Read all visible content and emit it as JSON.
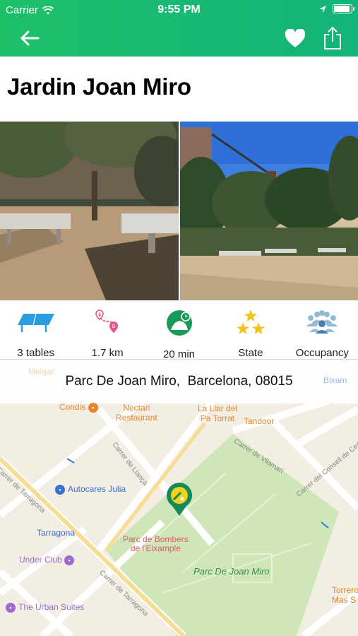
{
  "status_bar": {
    "carrier": "Carrier",
    "time": "9:55 PM"
  },
  "header": {
    "back_icon": "arrow-left-icon",
    "favorite_icon": "heart-icon",
    "share_icon": "share-icon"
  },
  "title": "Jardin Joan Miro",
  "stats": [
    {
      "icon": "ping-pong-table-icon",
      "label": "3 tables"
    },
    {
      "icon": "route-distance-icon",
      "label": "1.7 km"
    },
    {
      "icon": "duration-icon",
      "label": "20 min"
    },
    {
      "icon": "stars-icon",
      "label": "State"
    },
    {
      "icon": "crowd-icon",
      "label": "Occupancy"
    }
  ],
  "map": {
    "address": "Parc De Joan Miro,  Barcelona, 08015",
    "labels": {
      "melgar": "Melgar",
      "condis": "Condis",
      "nectari_1": "Nectari",
      "nectari_2": "Restaurant",
      "llar_1": "La Llar del",
      "llar_2": "Pa Torrat",
      "tandoor": "Tandoor",
      "autocares": "Autocares Julia",
      "tarragona_station": "Tarragona",
      "under_club": "Under Club",
      "urban_suites": "The Urban Suites",
      "bombers_1": "Parc de Bombers",
      "bombers_2": "de l'Eixample",
      "park": "Parc De Joan Miro",
      "torrero_1": "Torrero",
      "torrero_2": "Mas S",
      "bixam": "Bixam",
      "street_tarragona": "Carrer de Tarragona",
      "street_tarragona2": "Carrer de Tarragona",
      "street_llanca": "Carrer de Llançà",
      "street_vilamari": "Carrer de Vilamarí",
      "street_consell": "Carrer del Consell de Cent"
    }
  },
  "colors": {
    "header": "#1cbc6d",
    "accent_green": "#1a9a5a",
    "icon_blue": "#2a9de0"
  }
}
